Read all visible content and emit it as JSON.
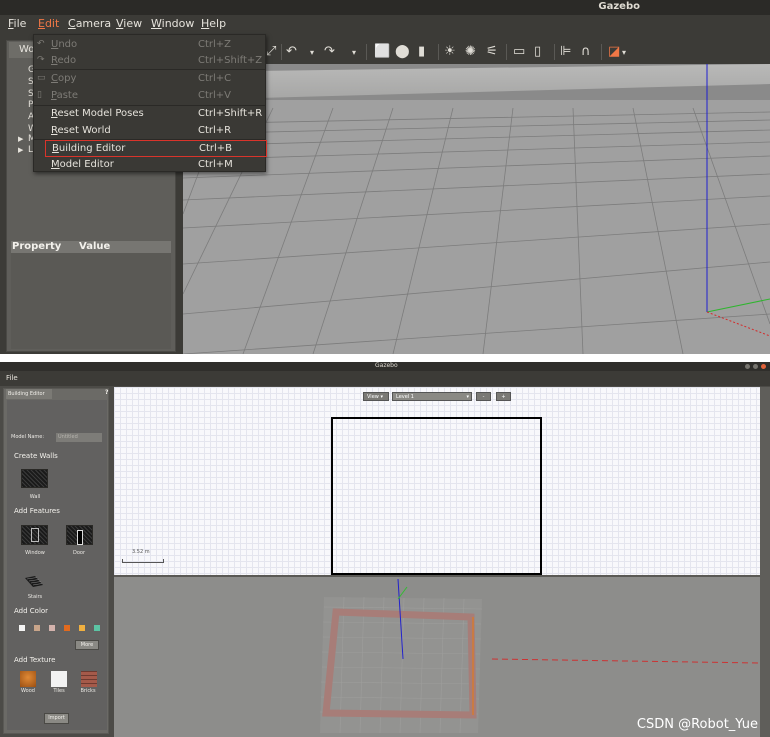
{
  "top": {
    "window_title": "Gazebo",
    "menus": [
      {
        "label": "File",
        "mnemonic": "F",
        "rest": "ile"
      },
      {
        "label": "Edit",
        "mnemonic": "E",
        "rest": "dit"
      },
      {
        "label": "Camera",
        "mnemonic": "C",
        "rest": "amera"
      },
      {
        "label": "View",
        "mnemonic": "V",
        "rest": "iew"
      },
      {
        "label": "Window",
        "mnemonic": "W",
        "rest": "indow"
      },
      {
        "label": "Help",
        "mnemonic": "H",
        "rest": "elp"
      }
    ],
    "world_tab": "Wo",
    "tree_letters": [
      "G",
      "S",
      "S",
      "P",
      "A",
      "W",
      "M",
      "L"
    ],
    "property_header": {
      "property": "Property",
      "value": "Value"
    },
    "edit_menu": {
      "undo": {
        "mnemonic": "U",
        "rest": "ndo",
        "shortcut": "Ctrl+Z"
      },
      "redo": {
        "mnemonic": "R",
        "rest": "edo",
        "shortcut": "Ctrl+Shift+Z"
      },
      "copy": {
        "mnemonic": "C",
        "rest": "opy",
        "shortcut": "Ctrl+C"
      },
      "paste": {
        "mnemonic": "P",
        "rest": "aste",
        "shortcut": "Ctrl+V"
      },
      "reset_model_poses": {
        "mnemonic": "R",
        "rest": "eset Model Poses",
        "shortcut": "Ctrl+Shift+R"
      },
      "reset_world": {
        "mnemonic": "R",
        "rest": "eset World",
        "shortcut": "Ctrl+R"
      },
      "building_editor": {
        "mnemonic": "B",
        "rest": "uilding Editor",
        "shortcut": "Ctrl+B"
      },
      "model_editor": {
        "mnemonic": "M",
        "rest": "odel Editor",
        "shortcut": "Ctrl+M"
      }
    }
  },
  "bottom": {
    "window_title": "Gazebo",
    "menu_file": "File",
    "panel_tab": "Building Editor",
    "help": "?",
    "model_name_label": "Model Name:",
    "model_name_value": "Untitled",
    "create_walls": "Create Walls",
    "wall": "Wall",
    "add_features": "Add Features",
    "window": "Window",
    "door": "Door",
    "stairs": "Stairs",
    "add_color": "Add Color",
    "colors": [
      "#f4f4f4",
      "#c9a58a",
      "#d4b3ad",
      "#e26a1e",
      "#f0b040",
      "#5cc4a4"
    ],
    "more": "More",
    "add_texture": "Add Texture",
    "textures": [
      "Wood",
      "Tiles",
      "Bricks"
    ],
    "import": "Import",
    "view_btn": "View",
    "level": "Level 1",
    "minus": "-",
    "plus": "+",
    "scale_label": "3.52 m"
  },
  "watermark": "CSDN @Robot_Yue"
}
